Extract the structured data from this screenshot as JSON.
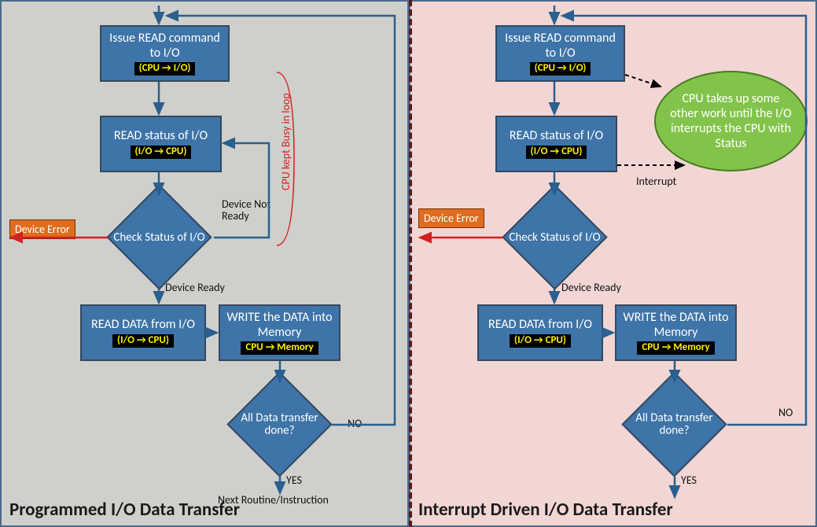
{
  "colors": {
    "box_fill": "#3e74a8",
    "box_border": "#35485e",
    "tag_bg": "#000000",
    "tag_text": "#fff200",
    "error_bg": "#e06c1e",
    "left_bg": "#cfd0cc",
    "right_bg": "#f1d6d4",
    "ellipse_bg": "#82c44b",
    "arrow_blue": "#2a5f8e",
    "arrow_red": "#d32020"
  },
  "left": {
    "title": "Programmed I/O Data Transfer",
    "box_issue": "Issue READ command to I/O",
    "tag_issue": "(CPU → I/O)",
    "box_status": "READ status of I/O",
    "tag_status": "(I/O → CPU)",
    "diamond_check": "Check Status of I/O",
    "lbl_not_ready": "Device Not Ready",
    "lbl_ready": "Device Ready",
    "err": "Device Error",
    "box_read": "READ DATA from I/O",
    "tag_read": "(I/O → CPU)",
    "box_write": "WRITE the DATA into Memory",
    "tag_write": "CPU → Memory",
    "diamond_done": "All Data transfer done?",
    "lbl_no": "NO",
    "lbl_yes": "YES",
    "lbl_next": "Next Routine/Instruction",
    "busy_loop": "CPU kept Busy in loop"
  },
  "right": {
    "title": "Interrupt Driven I/O Data Transfer",
    "box_issue": "Issue READ command to I/O",
    "tag_issue": "(CPU → I/O)",
    "box_status": "READ status of I/O",
    "tag_status": "(I/O → CPU)",
    "diamond_check": "Check Status of I/O",
    "lbl_ready": "Device Ready",
    "err": "Device Error",
    "box_read": "READ DATA from I/O",
    "tag_read": "(I/O → CPU)",
    "box_write": "WRITE the DATA into Memory",
    "tag_write": "CPU → Memory",
    "diamond_done": "All Data transfer done?",
    "lbl_no": "NO",
    "lbl_yes": "YES",
    "ellipse": "CPU takes up some other work until the I/O interrupts the CPU with Status",
    "lbl_interrupt": "Interrupt"
  }
}
